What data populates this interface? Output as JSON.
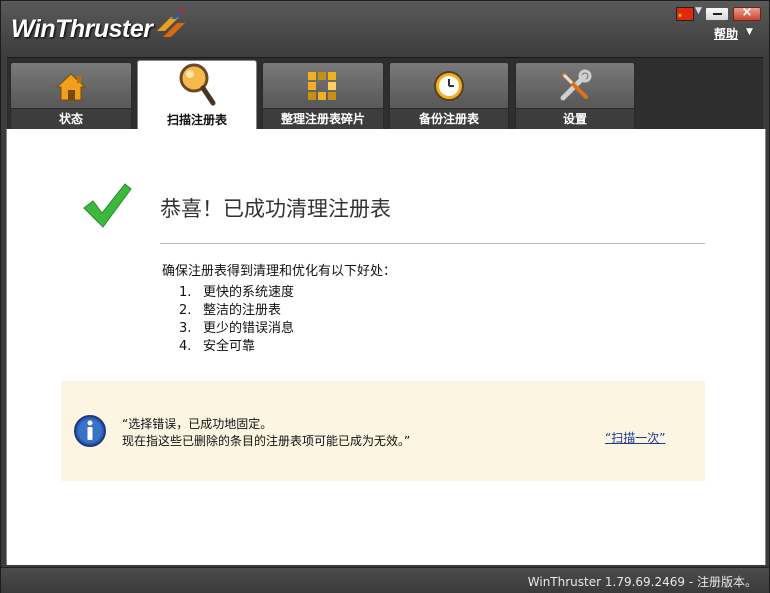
{
  "app": {
    "logo_text": "WinThruster",
    "help_label": "帮助"
  },
  "tabs": [
    {
      "label": "状态",
      "icon": "home-icon",
      "active": false
    },
    {
      "label": "扫描注册表",
      "icon": "magnifier-icon",
      "active": true
    },
    {
      "label": "整理注册表碎片",
      "icon": "defrag-blocks-icon",
      "active": false
    },
    {
      "label": "备份注册表",
      "icon": "clock-backup-icon",
      "active": false
    },
    {
      "label": "设置",
      "icon": "wrench-screwdriver-icon",
      "active": false
    }
  ],
  "main": {
    "title": "恭喜！已成功清理注册表",
    "intro": "确保注册表得到清理和优化有以下好处：",
    "benefits": [
      {
        "num": "1.",
        "text": "更快的系统速度"
      },
      {
        "num": "2.",
        "text": "整洁的注册表"
      },
      {
        "num": "3.",
        "text": "更少的错误消息"
      },
      {
        "num": "4.",
        "text": "安全可靠"
      }
    ],
    "info": {
      "line1": "“选择错误，已成功地固定。",
      "line2": "现在指这些已删除的条目的注册表项可能已成为无效。”",
      "rescan_link": "“扫描一次”"
    }
  },
  "status": {
    "version_text": "WinThruster 1.79.69.2469 - 注册版本。"
  },
  "colors": {
    "accent_green": "#3cb83c",
    "info_background": "#fcf5e1",
    "link": "#1a3a9a",
    "flag_red": "#de2910"
  }
}
